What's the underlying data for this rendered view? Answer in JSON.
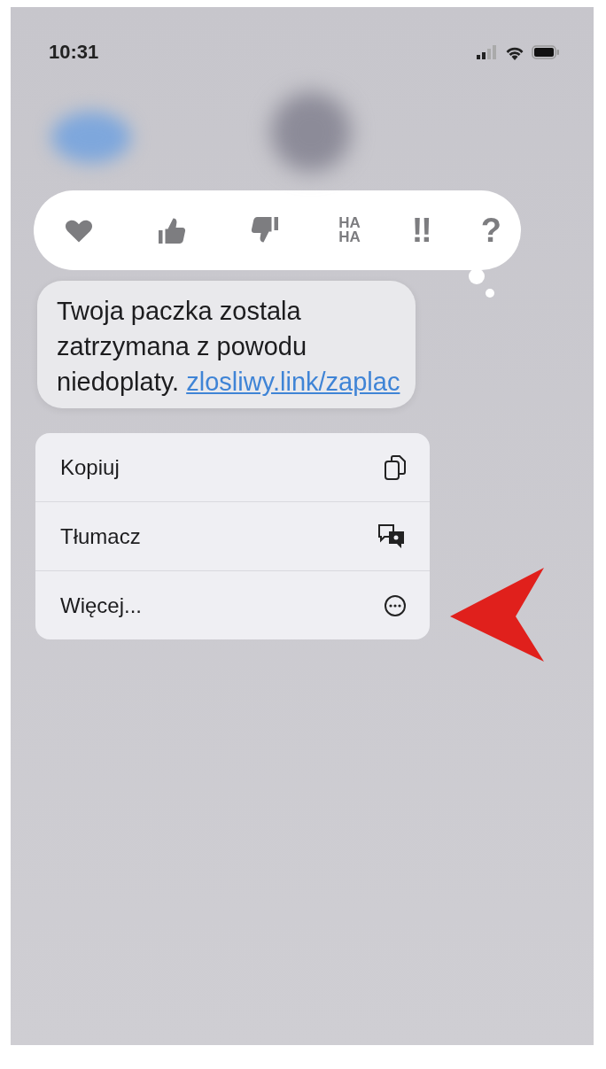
{
  "status_bar": {
    "time": "10:31"
  },
  "reactions": [
    {
      "kind": "heart"
    },
    {
      "kind": "thumbs-up"
    },
    {
      "kind": "thumbs-down"
    },
    {
      "kind": "text",
      "text": "HA HA"
    },
    {
      "kind": "text",
      "text": "‼"
    },
    {
      "kind": "text",
      "text": "?"
    }
  ],
  "message": {
    "lines": [
      "Twoja paczka zostala",
      "zatrzymana z powodu",
      "niedoplaty."
    ],
    "link": "zlosliwy.link/zaplac"
  },
  "menu": [
    {
      "label": "Kopiuj",
      "kind": "copy"
    },
    {
      "label": "Tłumacz",
      "kind": "translate"
    },
    {
      "label": "Więcej...",
      "kind": "more"
    }
  ]
}
